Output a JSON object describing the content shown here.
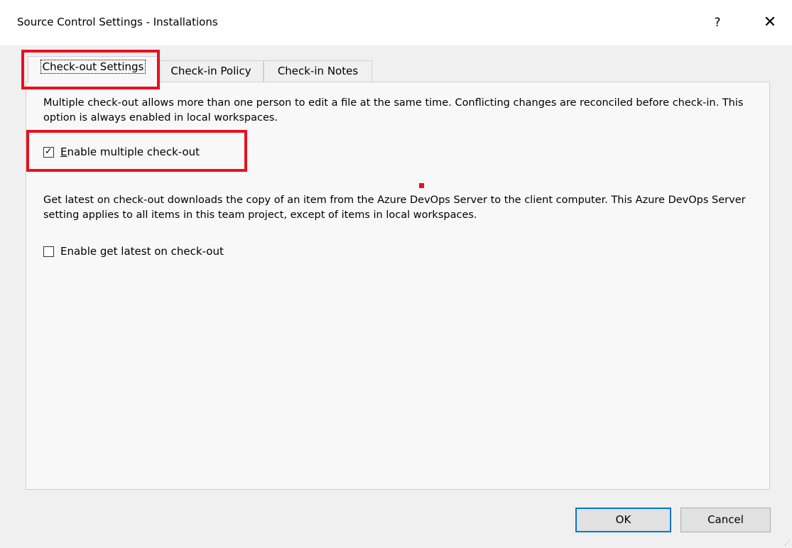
{
  "window": {
    "title": "Source Control Settings - Installations",
    "help_glyph": "?",
    "close_glyph": "✕"
  },
  "tabs": [
    {
      "label": "Check-out Settings",
      "active": true
    },
    {
      "label": "Check-in Policy",
      "active": false
    },
    {
      "label": "Check-in Notes",
      "active": false
    }
  ],
  "checkout": {
    "multiple_description": "Multiple check-out allows more than one person to edit a file at the same time. Conflicting changes are reconciled before check-in. This option is always enabled in local workspaces.",
    "multiple_checkbox": {
      "mnemonic": "E",
      "rest": "nable multiple check-out",
      "checked": true
    },
    "latest_description": "Get latest on check-out downloads the copy of an item from the Azure DevOps Server to the client computer. This Azure DevOps Server setting applies to all items in this team project, except of items in local workspaces.",
    "latest_checkbox": {
      "before": "Enable ",
      "mnemonic": "g",
      "after": "et latest on check-out",
      "checked": false
    }
  },
  "buttons": {
    "ok": "OK",
    "cancel": "Cancel"
  },
  "colors": {
    "highlight": "#e8101f",
    "ok_border": "#0078d7"
  },
  "icons": {
    "check": "✓"
  }
}
